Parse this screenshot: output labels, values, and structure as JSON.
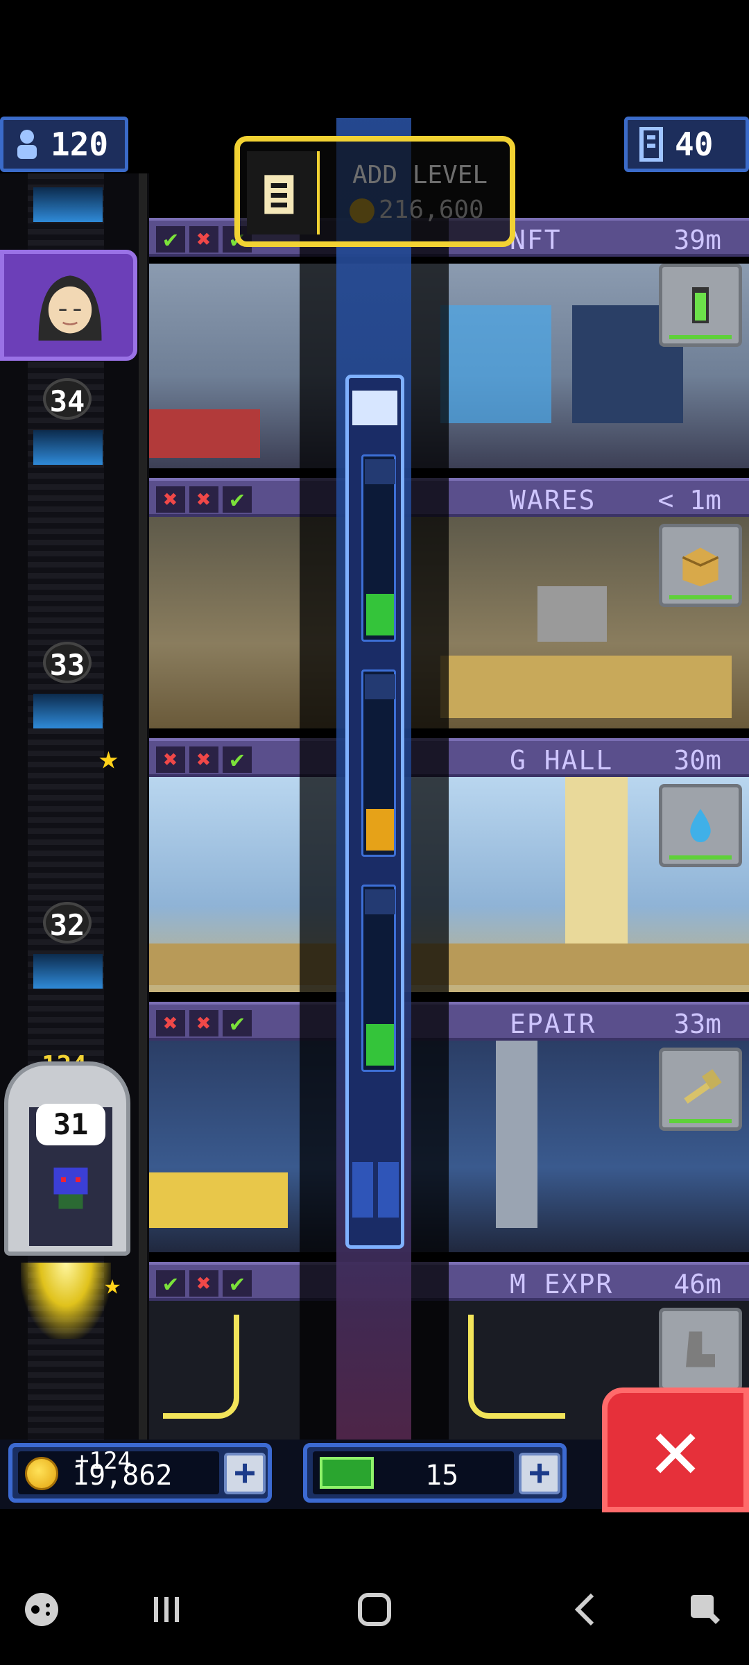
{
  "hud": {
    "population": "120",
    "floors": "40",
    "population_icon": "person-icon",
    "floors_icon": "building-icon"
  },
  "add_level": {
    "title": "ADD LEVEL",
    "cost": "216,600"
  },
  "elevator": {
    "floor_labels": [
      "34",
      "33",
      "32"
    ],
    "current_floor": "31",
    "passenger_count": "124"
  },
  "floors": [
    {
      "checks": [
        "ok",
        "no",
        "ok"
      ],
      "name": "NFT",
      "time": "39m",
      "icon": "battery-icon"
    },
    {
      "checks": [
        "no",
        "no",
        "ok"
      ],
      "name": "WARES",
      "time": "< 1m",
      "icon": "crate-icon"
    },
    {
      "checks": [
        "no",
        "no",
        "ok"
      ],
      "name": "G HALL",
      "time": "30m",
      "icon": "water-drop-icon"
    },
    {
      "checks": [
        "no",
        "no",
        "ok"
      ],
      "name": "EPAIR",
      "time": "33m",
      "icon": "hammer-icon"
    },
    {
      "checks": [
        "ok",
        "no",
        "ok"
      ],
      "name": "M EXPR",
      "time": "46m",
      "icon": "boot-icon"
    }
  ],
  "money": {
    "coins": "19,862",
    "coins_delta": "+124",
    "bux": "15"
  },
  "colors": {
    "accent_yellow": "#f2d233",
    "bar_purple": "#5a4f8c",
    "panel_blue": "#1a2f63",
    "close_red": "#e6303a",
    "check_green": "#7be23a",
    "cross_red": "#f04848"
  }
}
